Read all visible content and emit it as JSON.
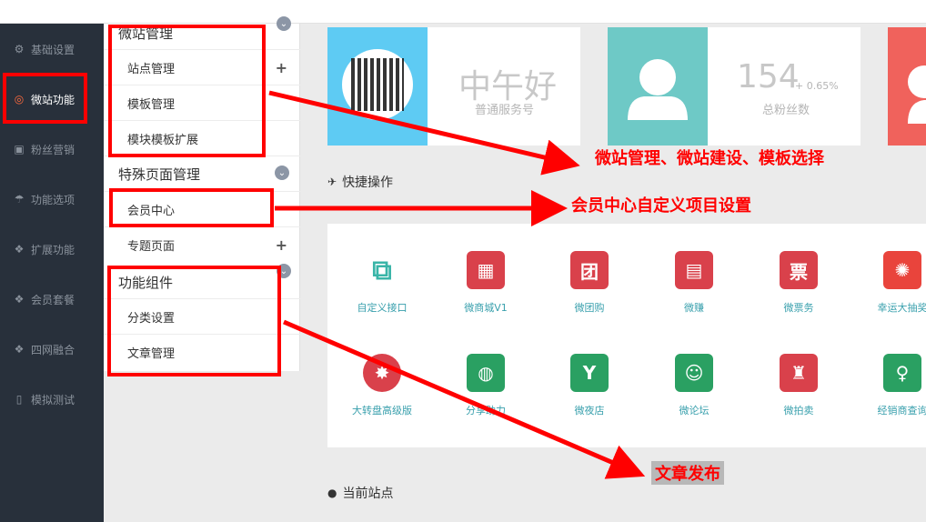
{
  "sidebar": {
    "items": [
      {
        "label": "基础设置",
        "icon": "gear-icon"
      },
      {
        "label": "微站功能",
        "icon": "lifebuoy-icon"
      },
      {
        "label": "粉丝营销",
        "icon": "gift-icon"
      },
      {
        "label": "功能选项",
        "icon": "umbrella-icon"
      },
      {
        "label": "扩展功能",
        "icon": "cubes-icon"
      },
      {
        "label": "会员套餐",
        "icon": "cubes-icon"
      },
      {
        "label": "四网融合",
        "icon": "cubes-icon"
      },
      {
        "label": "模拟测试",
        "icon": "mobile-icon"
      }
    ]
  },
  "subnav": {
    "group1_title": "微站管理",
    "group1_items": [
      "站点管理",
      "模板管理",
      "模块模板扩展"
    ],
    "group2_title": "特殊页面管理",
    "group2_items": [
      "会员中心",
      "专题页面"
    ],
    "group3_title": "功能组件",
    "group3_items": [
      "分类设置",
      "文章管理"
    ]
  },
  "cards": {
    "card1_big": "中午好",
    "card1_small": "普通服务号",
    "card2_big": "154",
    "card2_change": "+ 0.65%",
    "card2_small": "总粉丝数"
  },
  "quick_ops": {
    "title": "快捷操作",
    "tiles": [
      {
        "label": "自定义接口",
        "glyph": "⧉",
        "color": "#ffffff"
      },
      {
        "label": "微商城V1",
        "glyph": "▦",
        "color": "#d9414b"
      },
      {
        "label": "微团购",
        "glyph": "团",
        "color": "#d9414b"
      },
      {
        "label": "微赚",
        "glyph": "▤",
        "color": "#d9414b"
      },
      {
        "label": "微票务",
        "glyph": "票",
        "color": "#d9414b"
      },
      {
        "label": "幸运大抽奖",
        "glyph": "✺",
        "color": "#e9443c"
      },
      {
        "label": "大转盘高级版",
        "glyph": "✸",
        "color": "#d9414b"
      },
      {
        "label": "分享助力",
        "glyph": "◍",
        "color": "#2aa062"
      },
      {
        "label": "微夜店",
        "glyph": "Y",
        "color": "#2aa062"
      },
      {
        "label": "微论坛",
        "glyph": "☺",
        "color": "#2aa062"
      },
      {
        "label": "微拍卖",
        "glyph": "♜",
        "color": "#d9414b"
      },
      {
        "label": "经销商查询",
        "glyph": "♀",
        "color": "#2aa062"
      }
    ]
  },
  "current_site": {
    "title": "当前站点"
  },
  "annotations": {
    "a1": "微站管理、微站建设、模板选择",
    "a2": "会员中心自定义项目设置",
    "a3": "文章发布"
  },
  "colors": {
    "card1_accent": "#5ecbf3",
    "card2_accent": "#6ec9c6",
    "card3_accent": "#f0625c",
    "annotation_red": "#ff0000"
  }
}
